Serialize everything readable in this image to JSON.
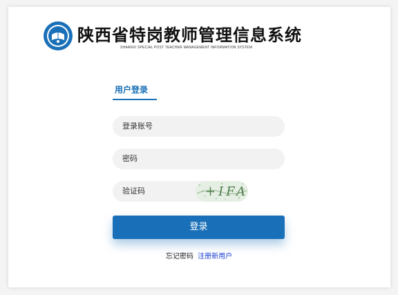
{
  "header": {
    "title": "陕西省特岗教师管理信息系统",
    "subtitle": "SHAANXI SPECIAL POST TEACHER MANAGEMENT INFORMATION SYSTEM"
  },
  "login": {
    "tab_label": "用户登录",
    "account_placeholder": "登录账号",
    "password_placeholder": "密码",
    "captcha_placeholder": "验证码",
    "captcha_text": "+IFA",
    "submit_label": "登录",
    "forgot_label": "忘记密码",
    "register_label": "注册新用户"
  },
  "colors": {
    "accent": "#1a70b8",
    "link": "#1a3fd2",
    "field_bg": "#f2f2f2"
  }
}
